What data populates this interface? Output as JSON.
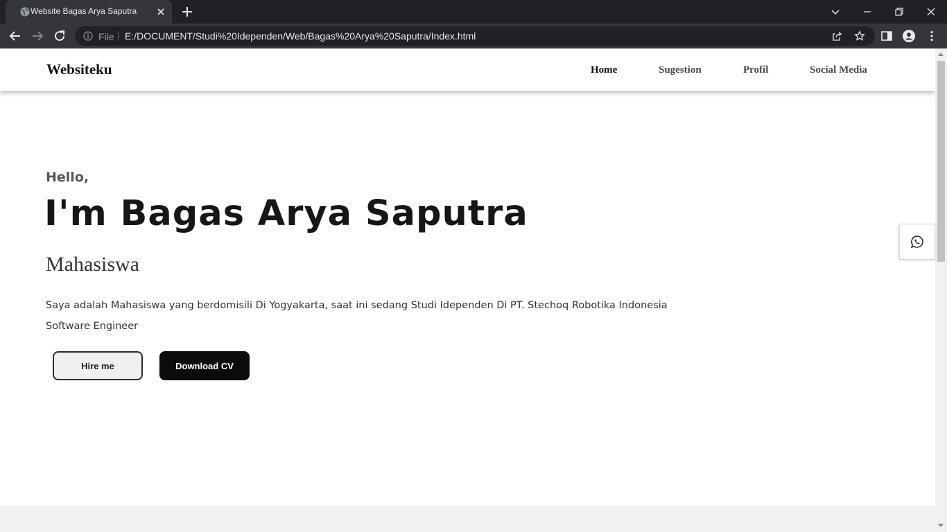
{
  "browser": {
    "tab": {
      "title": "Website Bagas Arya Saputra"
    },
    "address": {
      "scheme_label": "File",
      "url": "E:/DOCUMENT/Studi%20Idependen/Web/Bagas%20Arya%20Saputra/Index.html"
    }
  },
  "site": {
    "brand": "Websiteku",
    "nav": [
      {
        "label": "Home"
      },
      {
        "label": "Sugestion"
      },
      {
        "label": "Profil"
      },
      {
        "label": "Social Media"
      }
    ]
  },
  "hero": {
    "greeting": "Hello,",
    "name": "I'm Bagas Arya Saputra",
    "role": "Mahasiswa",
    "description_lines": [
      "Saya adalah Mahasiswa yang berdomisili Di Yogyakarta, saat ini sedang Studi Idependen Di PT. Stechoq Robotika Indonesia",
      "Software Engineer"
    ],
    "buttons": {
      "hire": "Hire me",
      "cv": "Download CV"
    }
  },
  "floating": {
    "icon": "whatsapp-icon"
  },
  "colors": {
    "chrome_dark": "#202124",
    "chrome_toolbar": "#35363a",
    "primary_button": "#0b0b0b",
    "section_alt_bg": "#f3f2f3"
  }
}
